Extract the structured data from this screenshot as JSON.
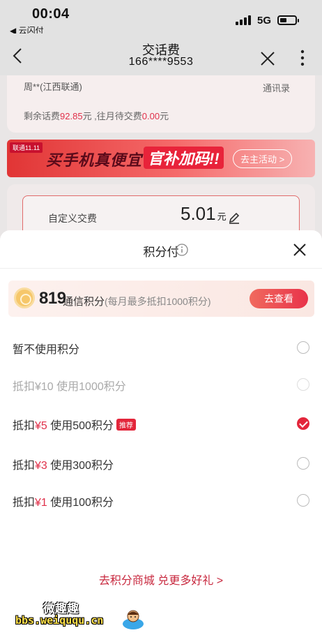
{
  "status_bar": {
    "time": "00:04",
    "back_app": "◀ 云闪付",
    "network": "5G"
  },
  "nav": {
    "title": "交话费",
    "phone": "166****9553"
  },
  "account_card": {
    "name": "周**(江西联通)",
    "contacts": "通讯录",
    "balance_prefix": "剩余话费",
    "balance": "92.85",
    "balance_mid": "元 ,往月待交费",
    "pending": "0.00",
    "pending_unit": "元"
  },
  "banner": {
    "tag": "联通11.11",
    "text": "买手机真便宜",
    "highlight": "官补加码!!",
    "cta": "去主活动 >"
  },
  "custom_pay": {
    "label": "自定义交费",
    "amount": "5.01",
    "unit": "元"
  },
  "sheet": {
    "title": "积分付",
    "points": {
      "value": "819",
      "label": "通信积分",
      "note": "(每月最多抵扣1000积分)",
      "button": "去查看"
    },
    "options": [
      {
        "label": "暂不使用积分",
        "state": "unselected"
      },
      {
        "label": "抵扣¥10 使用1000积分",
        "state": "disabled"
      },
      {
        "label_prefix": "抵扣",
        "amount": "¥5",
        "label_suffix": " 使用500积分",
        "badge": "推荐",
        "state": "selected"
      },
      {
        "label_prefix": "抵扣",
        "amount": "¥3",
        "label_suffix": " 使用300积分",
        "state": "unselected"
      },
      {
        "label_prefix": "抵扣",
        "amount": "¥1",
        "label_suffix": " 使用100积分",
        "state": "unselected"
      }
    ],
    "mall_link": "去积分商城 兑更多好礼 >"
  },
  "watermark": {
    "top": "微趣趣",
    "bottom": "bbs.weiququ.cn"
  },
  "colors": {
    "accent": "#e3263b",
    "link": "#c8283e",
    "overlay": "#e9e6e6"
  }
}
